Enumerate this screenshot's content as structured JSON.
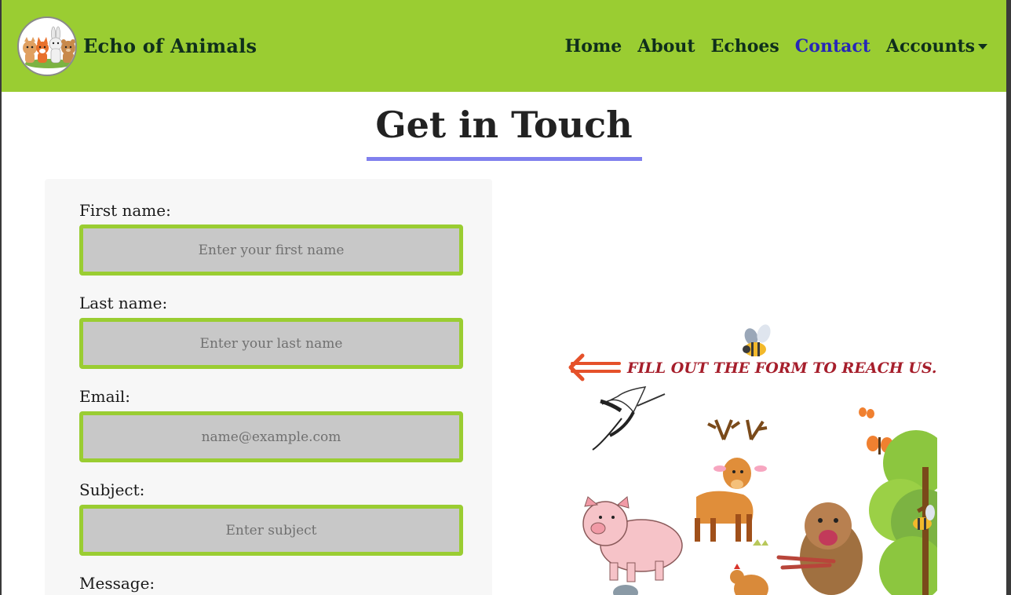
{
  "brand": {
    "name": "Echo of Animals",
    "logo_icon": "animals-logo-icon"
  },
  "nav": {
    "items": [
      {
        "label": "Home",
        "active": false
      },
      {
        "label": "About",
        "active": false
      },
      {
        "label": "Echoes",
        "active": false
      },
      {
        "label": "Contact",
        "active": true
      },
      {
        "label": "Accounts",
        "active": false,
        "dropdown": true
      }
    ]
  },
  "page": {
    "title": "Get in Touch"
  },
  "form": {
    "first_name": {
      "label": "First name:",
      "placeholder": "Enter your first name",
      "value": ""
    },
    "last_name": {
      "label": "Last name:",
      "placeholder": "Enter your last name",
      "value": ""
    },
    "email": {
      "label": "Email:",
      "placeholder": "name@example.com",
      "value": ""
    },
    "subject": {
      "label": "Subject:",
      "placeholder": "Enter subject",
      "value": ""
    },
    "message": {
      "label": "Message:"
    }
  },
  "illustration": {
    "cta": "FILL OUT THE FORM TO REACH US.",
    "arrow_icon": "arrow-left-icon"
  },
  "colors": {
    "navbar": "#9acd32",
    "nav_text": "#0f2f1c",
    "nav_active": "#2727b8",
    "underline": "#8080ee",
    "input_border": "#9acd32",
    "input_bg": "#c8c8c8",
    "cta": "#a61e2b"
  }
}
